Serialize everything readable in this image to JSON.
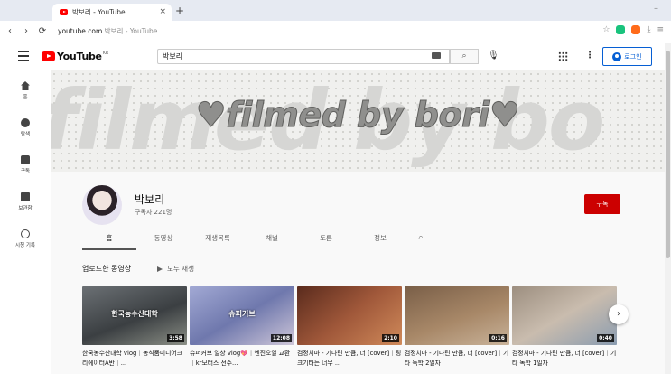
{
  "browser": {
    "tab_title": "박보리 - YouTube",
    "tab_close": "×",
    "new_tab": "+",
    "address": "youtube.com",
    "address_title": "박보리 - YouTube",
    "nav_back": "‹",
    "nav_forward": "›",
    "nav_reload": "⟳",
    "colors": {
      "ext1": "#19c37d",
      "ext2": "#ff6b1a"
    }
  },
  "header": {
    "logo_text": "YouTube",
    "logo_region": "KR",
    "search_value": "박보리",
    "search_button": "⌕",
    "login_label": "로그인"
  },
  "sidebar": {
    "items": [
      {
        "label": "홈",
        "icon": "home-icon"
      },
      {
        "label": "탐색",
        "icon": "compass-icon"
      },
      {
        "label": "구독",
        "icon": "subscriptions-icon"
      },
      {
        "label": "보관함",
        "icon": "library-icon"
      },
      {
        "label": "시청 기록",
        "icon": "history-icon"
      }
    ]
  },
  "banner": {
    "ghost_text": "filmed by bo",
    "title": "♥filmed by bori♥"
  },
  "channel": {
    "name": "박보리",
    "subscribers": "구독자 221명",
    "subscribe_label": "구독",
    "tabs": [
      "홈",
      "동영상",
      "재생목록",
      "채널",
      "토론",
      "정보"
    ],
    "search_tab_icon": "⌕"
  },
  "section": {
    "title": "업로드한 동영상",
    "play_all": "모두 재생",
    "next_icon": "›",
    "videos": [
      {
        "title": "한국농수산대학 vlog｜농식품미디어크리에이터A반｜...",
        "duration": "3:58",
        "overlay": "한국농수산대학",
        "color": "#4a4f52"
      },
      {
        "title": "슈퍼커브 일상 vlog💖｜엔진오일 교환｜kr모터스 전주...",
        "duration": "12:08",
        "overlay": "슈퍼커브",
        "color": "#7d87b8"
      },
      {
        "title": "검정치마 - 기다린 만큼, 더 [cover]｜링크기타는 너무 ...",
        "duration": "2:10",
        "overlay": "",
        "color": "#8a4a33"
      },
      {
        "title": "검정치마 - 기다린 만큼, 더 [cover]｜기타 독학 2일차",
        "duration": "0:16",
        "overlay": "",
        "color": "#9a7a5e"
      },
      {
        "title": "검정치마 - 기다린 만큼, 더 [cover]｜기타 독학 1일차",
        "duration": "0:40",
        "overlay": "",
        "color": "#b7a99a"
      }
    ]
  }
}
